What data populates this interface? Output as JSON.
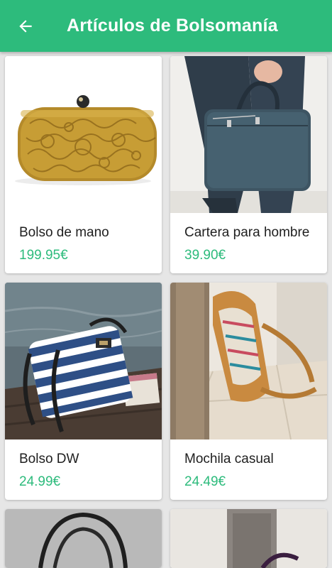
{
  "appbar": {
    "title": "Artículos de Bolsomanía",
    "back_icon": "arrow-left-icon",
    "color": "#2dbb7c"
  },
  "products": [
    {
      "name": "Bolso de mano",
      "price": "199.95€"
    },
    {
      "name": "Cartera para hombre",
      "price": "39.90€"
    },
    {
      "name": "Bolso DW",
      "price": "24.99€"
    },
    {
      "name": "Mochila casual",
      "price": "24.49€"
    }
  ],
  "colors": {
    "price": "#2dbb7c",
    "background": "#e6e6e6"
  }
}
